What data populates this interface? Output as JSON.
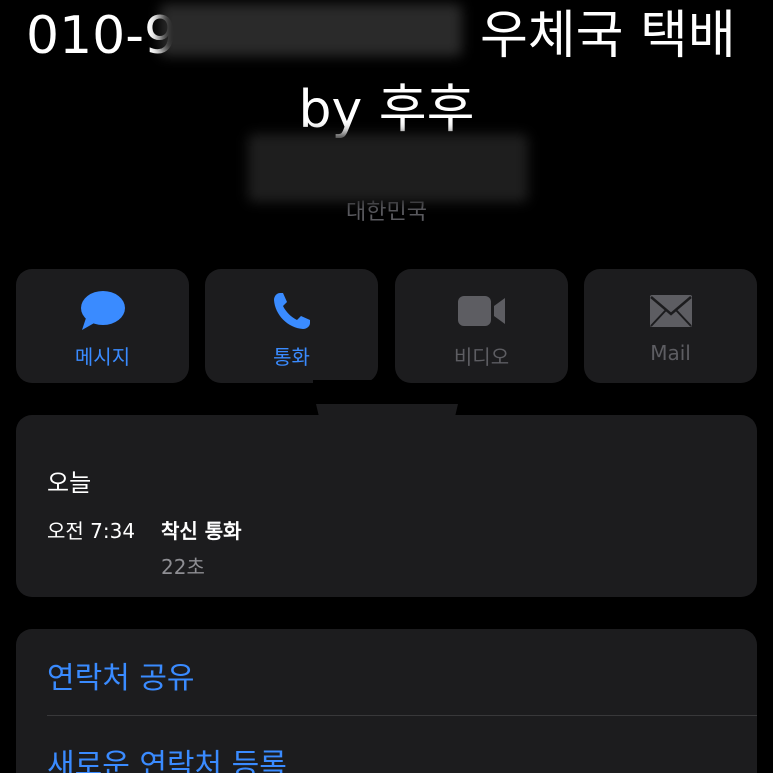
{
  "header": {
    "phone_prefix": "010-9",
    "name_suffix": "우체국 택배",
    "line2": "by 후후",
    "subtitle": "대한민국"
  },
  "actions": [
    {
      "label": "메시지",
      "icon": "message-bubble-icon",
      "state": "enabled"
    },
    {
      "label": "통화",
      "icon": "phone-icon",
      "state": "enabled"
    },
    {
      "label": "비디오",
      "icon": "video-camera-icon",
      "state": "disabled"
    },
    {
      "label": "Mail",
      "icon": "envelope-icon",
      "state": "disabled"
    }
  ],
  "recents": {
    "title": "오늘",
    "entry": {
      "time": "오전 7:34",
      "type": "착신 통화",
      "duration": "22초"
    }
  },
  "options": [
    {
      "label": "연락처 공유"
    },
    {
      "label": "새로운 연락처 등록"
    }
  ],
  "colors": {
    "accent": "#3a8bff",
    "disabled": "#5d5d62",
    "card": "#1c1c1e",
    "background": "#000000"
  }
}
